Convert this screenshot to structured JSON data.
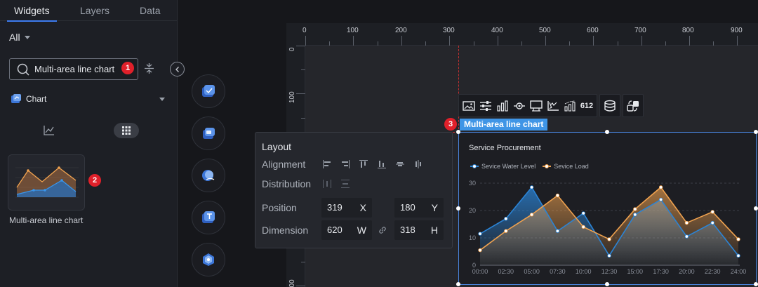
{
  "left_panel": {
    "tabs": [
      {
        "label": "Widgets"
      },
      {
        "label": "Layers"
      },
      {
        "label": "Data"
      }
    ],
    "filter_value": "All",
    "search_value": "Multi-area line chart",
    "category_label": "Chart",
    "widget_label": "Multi-area line chart"
  },
  "badges": {
    "search": "1",
    "widget": "2",
    "selected": "3"
  },
  "rail_icons": [
    "box-icon",
    "screen-icon",
    "globe-icon",
    "text-icon",
    "settings-cube-icon"
  ],
  "ruler": {
    "top_labels": [
      "0",
      "100",
      "200",
      "300",
      "400",
      "500",
      "600",
      "700",
      "800",
      "900"
    ],
    "left_labels": [
      "0",
      "100",
      "200"
    ]
  },
  "layout_popup": {
    "title": "Layout",
    "alignment_label": "Alignment",
    "distribution_label": "Distribution",
    "position_label": "Position",
    "dimension_label": "Dimension",
    "x_value": "319",
    "x_unit": "X",
    "y_value": "180",
    "y_unit": "Y",
    "w_value": "620",
    "w_unit": "W",
    "h_value": "318",
    "h_unit": "H"
  },
  "toolbar": {
    "items": [
      "image-icon",
      "sliders-icon",
      "bar-chart-icon",
      "eye-icon",
      "comment-icon",
      "axis-icon",
      "bar-chart-line-icon",
      "number-icon"
    ],
    "number_label": "612",
    "data_icon": "database-icon",
    "swap_icon": "swap-icon"
  },
  "widget_name": "Multi-area line chart",
  "colors": {
    "accent": "#3d7cf0",
    "series1": "#2b84d6",
    "series2": "#f0a24f",
    "badge": "#e0202a",
    "tag": "#3f95e6"
  },
  "chart_data": {
    "type": "area",
    "title": "Service Procurement",
    "x": [
      "00:00",
      "02:30",
      "05:00",
      "07:30",
      "10:00",
      "12:30",
      "15:00",
      "17:30",
      "20:00",
      "22:30",
      "24:00"
    ],
    "series": [
      {
        "name": "Sevice Water Level",
        "color": "#2b84d6",
        "values": [
          11.5,
          17,
          28.5,
          12.5,
          19,
          3.5,
          18.5,
          24,
          10.5,
          15.5,
          3.5
        ]
      },
      {
        "name": "Sevice Load",
        "color": "#f0a24f",
        "values": [
          5.5,
          12.5,
          18.5,
          25.5,
          14,
          9.5,
          20.5,
          28.5,
          15.5,
          19.5,
          9.5
        ]
      }
    ],
    "yticks": [
      "0",
      "10",
      "20",
      "30"
    ],
    "ylim": [
      0,
      30
    ],
    "grid": true,
    "legend": "top-left"
  }
}
